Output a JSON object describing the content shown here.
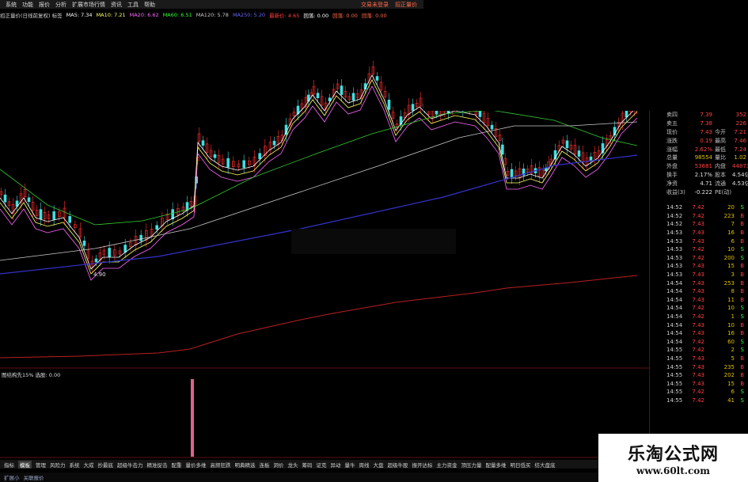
{
  "menu": {
    "items": [
      "系统",
      "功能",
      "报价",
      "分析",
      "扩展市场行情",
      "资讯",
      "工具",
      "帮助"
    ],
    "right": [
      "交易未登录",
      "招正量价"
    ]
  },
  "ma_bar": [
    {
      "label": "招正量价(日线前复权) 标签",
      "color": "#d0d0d0"
    },
    {
      "label": "MA5: 7.34",
      "color": "#ffffff"
    },
    {
      "label": "MA10: 7.21",
      "color": "#ffff66"
    },
    {
      "label": "MA20: 6.62",
      "color": "#ff66ff"
    },
    {
      "label": "MA60: 6.51",
      "color": "#33ff33"
    },
    {
      "label": "MA120: 5.78",
      "color": "#c8c8c8"
    },
    {
      "label": "MA250: 5.20",
      "color": "#6666ff"
    },
    {
      "label": "最新价: 4.65",
      "color": "#ff4040"
    },
    {
      "label": "回落: 0.00",
      "color": "#ffffff"
    },
    {
      "label": "回落: 0.00",
      "color": "#ff6a4a"
    },
    {
      "label": "回落: 0.00",
      "color": "#ff6a4a"
    }
  ],
  "chart": {
    "low_label": "4.90",
    "up_color": "#ff3030",
    "down_color": "#40e0e0",
    "colors": {
      "ma5": "#ffffff",
      "ma10": "#ffff66",
      "ma20": "#ff66ff",
      "ma60": "#33cc33",
      "ma120": "#c8c8c8",
      "ma250": "#3333cc",
      "bottom": "#b82020"
    }
  },
  "sub_title": "图结构先15% 选股: 0.00",
  "info": [
    {
      "l": "卖四",
      "v": "7.39",
      "l2": "",
      "v2": "352",
      "vc": "#ff4040"
    },
    {
      "l": "卖五",
      "v": "7.38",
      "l2": "",
      "v2": "226",
      "vc": "#ff4040"
    },
    {
      "l": "现价",
      "v": "7.43",
      "l2": "今开",
      "v2": "7.21",
      "vc": "#ff4040"
    },
    {
      "l": "涨跌",
      "v": "0.19",
      "l2": "最高",
      "v2": "7.46",
      "vc": "#ff4040"
    },
    {
      "l": "涨幅",
      "v": "2.62%",
      "l2": "最低",
      "v2": "7.24",
      "vc": "#ff4040"
    },
    {
      "l": "总量",
      "v": "98554",
      "l2": "量比",
      "v2": "1.02",
      "vc": "#e0c000"
    },
    {
      "l": "外盘",
      "v": "53681",
      "l2": "内盘",
      "v2": "44873",
      "vc": "#ff4040"
    },
    {
      "l": "换手",
      "v": "2.17%",
      "l2": "股本",
      "v2": "4.54亿",
      "vc": "#e0e0e0"
    },
    {
      "l": "净资",
      "v": "4.71",
      "l2": "流通",
      "v2": "4.53亿",
      "vc": "#e0e0e0"
    },
    {
      "l": "收益(3)",
      "v": "-0.222",
      "l2": "PE(动)",
      "v2": "",
      "vc": "#e0e0e0"
    }
  ],
  "ticks": [
    {
      "t": "14:52",
      "p": "7.42",
      "v": "20",
      "bs": "S"
    },
    {
      "t": "14:52",
      "p": "7.42",
      "v": "223",
      "bs": "B"
    },
    {
      "t": "14:52",
      "p": "7.43",
      "v": "7",
      "bs": "B"
    },
    {
      "t": "14:53",
      "p": "7.43",
      "v": "16",
      "bs": "B"
    },
    {
      "t": "14:53",
      "p": "7.43",
      "v": "6",
      "bs": "B"
    },
    {
      "t": "14:53",
      "p": "7.42",
      "v": "10",
      "bs": "S"
    },
    {
      "t": "14:53",
      "p": "7.42",
      "v": "200",
      "bs": "S"
    },
    {
      "t": "14:53",
      "p": "7.43",
      "v": "15",
      "bs": "B"
    },
    {
      "t": "14:53",
      "p": "7.43",
      "v": "3",
      "bs": "B"
    },
    {
      "t": "14:54",
      "p": "7.43",
      "v": "253",
      "bs": "B"
    },
    {
      "t": "14:54",
      "p": "7.43",
      "v": "8",
      "bs": "B"
    },
    {
      "t": "14:54",
      "p": "7.43",
      "v": "11",
      "bs": "B"
    },
    {
      "t": "14:54",
      "p": "7.42",
      "v": "10",
      "bs": "S"
    },
    {
      "t": "14:54",
      "p": "7.42",
      "v": "1",
      "bs": "S"
    },
    {
      "t": "14:54",
      "p": "7.43",
      "v": "10",
      "bs": "B"
    },
    {
      "t": "14:54",
      "p": "7.43",
      "v": "16",
      "bs": "B"
    },
    {
      "t": "14:54",
      "p": "7.42",
      "v": "60",
      "bs": "S"
    },
    {
      "t": "14:55",
      "p": "7.42",
      "v": "2",
      "bs": "S"
    },
    {
      "t": "14:55",
      "p": "7.43",
      "v": "5",
      "bs": "B"
    },
    {
      "t": "14:55",
      "p": "7.43",
      "v": "235",
      "bs": "B"
    },
    {
      "t": "14:55",
      "p": "7.43",
      "v": "202",
      "bs": "B"
    },
    {
      "t": "14:55",
      "p": "7.43",
      "v": "15",
      "bs": "B"
    },
    {
      "t": "14:55",
      "p": "7.42",
      "v": "6",
      "bs": "S"
    },
    {
      "t": "14:55",
      "p": "7.42",
      "v": "41",
      "bs": "S"
    }
  ],
  "tabs": [
    "指标",
    "模板",
    "管理",
    "风险力",
    "系统",
    "大成",
    "抄最底",
    "超级牛击力",
    "精准捉击",
    "配重",
    "量价多维",
    "高频狂跌",
    "明典精选",
    "连板",
    "洞价",
    "龙头",
    "筹码",
    "证克",
    "异动",
    "量牛",
    "周线",
    "大盘",
    "超级牛股",
    "振开达标",
    "主力资金",
    "顶压力量",
    "配量多维",
    "明日低买",
    "纺大盘底"
  ],
  "active_tab": 1,
  "status": [
    "扩展小",
    "关联报价"
  ],
  "watermark": {
    "line1": "乐淘公式网",
    "line2": "www.60lt.com"
  }
}
